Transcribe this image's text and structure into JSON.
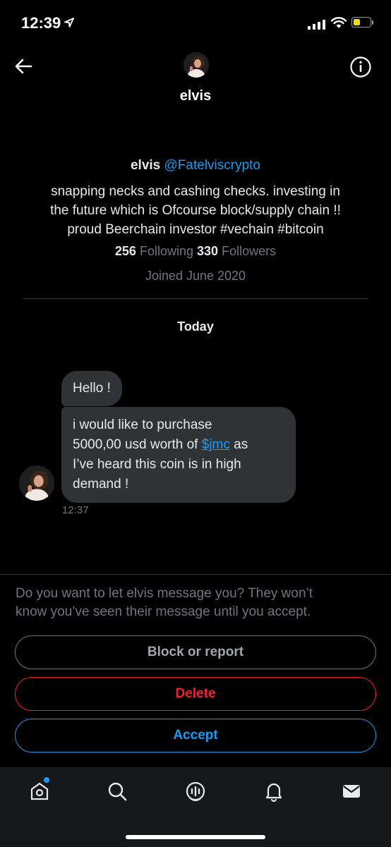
{
  "status_bar": {
    "time": "12:39"
  },
  "header": {
    "title": "elvis"
  },
  "profile": {
    "name": "elvis",
    "handle": "@Fatelviscrypto",
    "bio_line1": "snapping necks and cashing checks. investing in",
    "bio_line2": "the future which is Ofcourse block/supply chain !!",
    "bio_line3": "proud Beerchain investor #vechain #bitcoin",
    "following_count": "256",
    "following_label": "Following",
    "followers_count": "330",
    "followers_label": "Followers",
    "joined": "Joined June 2020"
  },
  "conversation": {
    "day_label": "Today",
    "messages": [
      {
        "text": "Hello !"
      },
      {
        "line1": "i would like to purchase",
        "line2_prefix": "5000,00 usd worth of ",
        "link": "$jmc",
        "line2_suffix": " as",
        "line3": "I’ve heard this coin is in high",
        "line4": "demand !"
      }
    ],
    "timestamp": "12:37"
  },
  "request": {
    "prompt_line1": "Do you want to let elvis message you? They won’t",
    "prompt_line2": "know you’ve seen their message until you accept.",
    "block_label": "Block or report",
    "delete_label": "Delete",
    "accept_label": "Accept"
  },
  "colors": {
    "accent": "#1d9bf0",
    "danger": "#f4212e",
    "bubble": "#2f3336",
    "muted": "#71767b",
    "battery": "#f5d90a"
  },
  "tab_bar": {
    "icons": [
      "home-icon",
      "search-icon",
      "spaces-icon",
      "notifications-icon",
      "messages-icon"
    ]
  }
}
